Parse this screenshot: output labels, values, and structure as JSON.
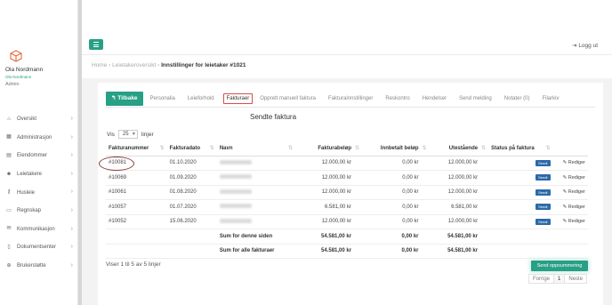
{
  "user": {
    "name": "Ola Nordmann",
    "sub": "Ola Nordmann",
    "role": "Admin"
  },
  "nav": [
    {
      "label": "Oversikt",
      "icon": "home-icon"
    },
    {
      "label": "Administrasjon",
      "icon": "building-icon"
    },
    {
      "label": "Eiendommer",
      "icon": "property-icon"
    },
    {
      "label": "Leietakere",
      "icon": "users-icon"
    },
    {
      "label": "Husleie",
      "icon": "key-icon"
    },
    {
      "label": "Regnskap",
      "icon": "ledger-icon"
    },
    {
      "label": "Kommunikasjon",
      "icon": "chat-icon"
    },
    {
      "label": "Dokumentsenter",
      "icon": "document-icon"
    },
    {
      "label": "Brukerstøtte",
      "icon": "lifebuoy-icon"
    }
  ],
  "header": {
    "logout": "Logg ut"
  },
  "breadcrumb": {
    "home": "Home",
    "sep1": "›",
    "mid": "Leietakeroversikt",
    "sep2": "›",
    "current": "Innstillinger for leietaker #1021"
  },
  "tabs": {
    "back": "Tilbake",
    "items": [
      "Personalia",
      "Leieforhold",
      "Fakturaer",
      "Opprett manuell faktura",
      "Fakturainnstillinger",
      "Reskontro",
      "Hendelser",
      "Send melding",
      "Notater (0)",
      "Filarkiv"
    ]
  },
  "section": {
    "title": "Sendte faktura"
  },
  "length": {
    "prefix": "Vis",
    "value": "25",
    "suffix": "linjer"
  },
  "table": {
    "headers": [
      "Fakturanummer",
      "Fakturadato",
      "Navn",
      "Fakturabeløp",
      "Innbetalt beløp",
      "Utestående",
      "Status på faktura"
    ],
    "rows": [
      {
        "nr": "#10081",
        "date": "01.10.2020",
        "amount": "12.000,00 kr",
        "paid": "0,00 kr",
        "out": "12.000,00 kr",
        "status": "Sendt",
        "edit": "Rediger"
      },
      {
        "nr": "#10069",
        "date": "01.09.2020",
        "amount": "12.000,00 kr",
        "paid": "0,00 kr",
        "out": "12.000,00 kr",
        "status": "Sendt",
        "edit": "Rediger"
      },
      {
        "nr": "#10061",
        "date": "01.08.2020",
        "amount": "12.000,00 kr",
        "paid": "0,00 kr",
        "out": "12.000,00 kr",
        "status": "Sendt",
        "edit": "Rediger"
      },
      {
        "nr": "#10057",
        "date": "01.07.2020",
        "amount": "6.581,00 kr",
        "paid": "0,00 kr",
        "out": "6.581,00 kr",
        "status": "Sendt",
        "edit": "Rediger"
      },
      {
        "nr": "#10052",
        "date": "15.06.2020",
        "amount": "12.000,00 kr",
        "paid": "0,00 kr",
        "out": "12.000,00 kr",
        "status": "Sendt",
        "edit": "Rediger"
      }
    ],
    "sum_page": {
      "label": "Sum for denne siden",
      "amount": "54.581,00 kr",
      "paid": "0,00 kr",
      "out": "54.581,00 kr"
    },
    "sum_all": {
      "label": "Sum for alle fakturaer",
      "amount": "54.581,00 kr",
      "paid": "0,00 kr",
      "out": "54.581,00 kr"
    }
  },
  "footer": {
    "info": "Viser 1 til 5 av 5 linjer",
    "send_button": "Send oppsummering",
    "prev": "Forrige",
    "page": "1",
    "next": "Neste"
  },
  "colors": {
    "accent": "#27a085",
    "badge": "#2b6aa8",
    "highlight": "#d94c4c"
  }
}
